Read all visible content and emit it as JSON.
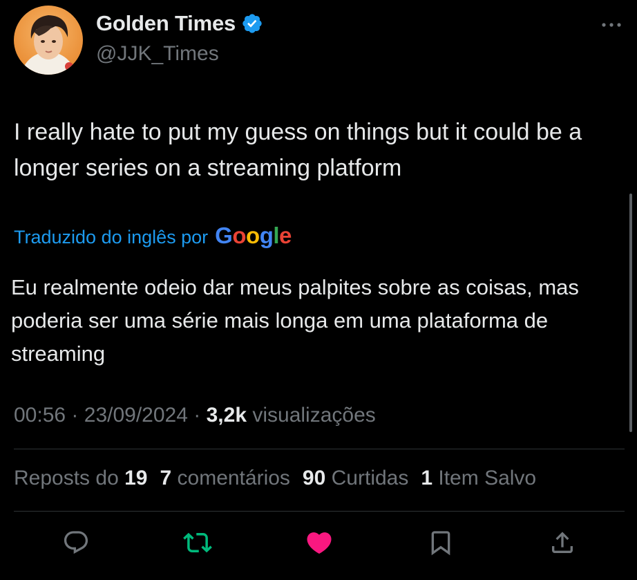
{
  "author": {
    "display_name": "Golden Times",
    "handle": "@JJK_Times",
    "verified": true
  },
  "tweet": {
    "text": "I really hate to put my guess on things but it could be a longer series on a streaming platform"
  },
  "translation": {
    "label": "Traduzido do inglês por",
    "provider": "Google",
    "text": "Eu realmente odeio dar meus palpites sobre as coisas, mas poderia ser uma série mais longa em uma plataforma de streaming"
  },
  "meta": {
    "time": "00:56",
    "separator": "·",
    "date": "23/09/2024",
    "views_count": "3,2k",
    "views_label": "visualizações"
  },
  "stats": {
    "reposts_label": "Reposts do",
    "reposts_count": "19",
    "comments_count": "7",
    "comments_label": "comentários",
    "likes_count": "90",
    "likes_label": "Curtidas",
    "saves_count": "1",
    "saves_label": "Item Salvo"
  },
  "actions": [
    {
      "name": "reply",
      "icon": "speech-bubble-icon",
      "active": false
    },
    {
      "name": "repost",
      "icon": "repost-icon",
      "active": true
    },
    {
      "name": "like",
      "icon": "heart-icon",
      "active": true
    },
    {
      "name": "bookmark",
      "icon": "bookmark-icon",
      "active": false
    },
    {
      "name": "share",
      "icon": "share-upload-icon",
      "active": false
    }
  ],
  "colors": {
    "background": "#000000",
    "text_primary": "#e7e9ea",
    "text_secondary": "#71767b",
    "link": "#1d9bf0",
    "verified_badge": "#1d9bf0",
    "repost_active": "#00ba7c",
    "like_active": "#f91880",
    "divider": "#2f3336"
  }
}
